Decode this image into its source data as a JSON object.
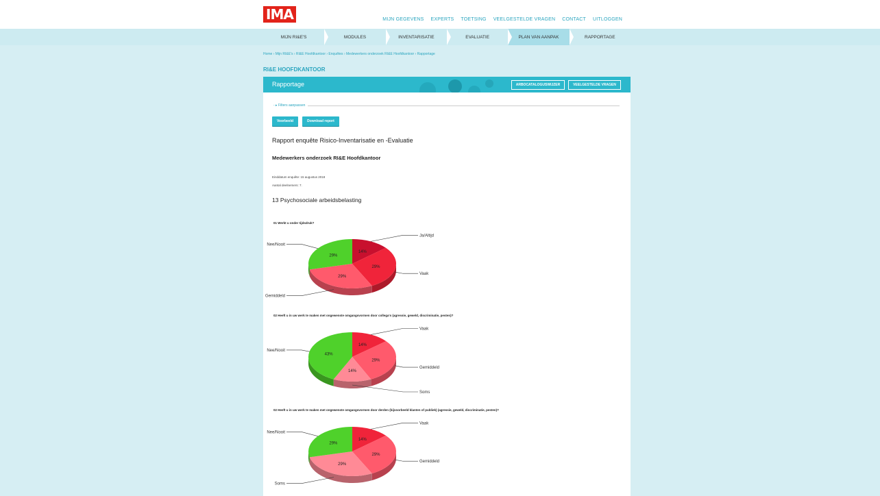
{
  "header": {
    "logo_text": "IMA",
    "nav": [
      "MIJN GEGEVENS",
      "EXPERTS",
      "TOETSING",
      "VEELGESTELDE VRAGEN",
      "CONTACT",
      "UITLOGGEN"
    ]
  },
  "mainnav": {
    "items": [
      "MIJN RI&E'S",
      "MODULES",
      "INVENTARISATIE",
      "EVALUATIE",
      "PLAN VAN AANPAK",
      "RAPPORTAGE"
    ],
    "active_index": 4
  },
  "breadcrumb": "Home › Mijn RI&E's › RI&E Hoofdkantoor › Enquêtes › Medewerkers onderzoek RI&E Hoofdkantoor › Rapportage",
  "section_title": "RI&E HOOFDKANTOOR",
  "panel": {
    "title": "Rapportage",
    "btn_catalog": "ARBOCATALOGUSWIJZER",
    "btn_faq": "VEELGESTELDE VRAGEN",
    "filters_label": "- ▸ Filters aanpassen",
    "btn_preview": "Voorbeeld",
    "btn_download": "Download report"
  },
  "report": {
    "title": "Rapport enquête Risico-Inventarisatie en -Evaluatie",
    "survey": "Medewerkers onderzoek RI&E Hoofdkantoor",
    "end_date": "Einddatum enquête: 15 augustus 2018",
    "participants": "Aantal deelnemers: 7.",
    "category": "13 Psychosociale arbeidsbelasting"
  },
  "colors": {
    "accent": "#2cb8cc",
    "link": "#2aa5bf",
    "green": "#4fd12b",
    "dark_red": "#c8102e",
    "red": "#f0243a",
    "pink": "#ff5a6c",
    "light_pink": "#ff8a96"
  },
  "chart_data": [
    {
      "type": "pie",
      "title": "01 Werkt u onder tijdsdruk?",
      "slices": [
        {
          "label": "Ja/Altijd",
          "value": 14,
          "color": "#c8102e"
        },
        {
          "label": "Vaak",
          "value": 29,
          "color": "#f0243a"
        },
        {
          "label": "Gemiddeld",
          "value": 29,
          "color": "#ff5a6c"
        },
        {
          "label": "Nee/Nooit",
          "value": 29,
          "color": "#4fd12b"
        }
      ]
    },
    {
      "type": "pie",
      "title": "02 Heeft u in uw werk te maken met ongewenste omgangsvormen door collega's (agressie, geweld, discriminatie, pesten)?",
      "slices": [
        {
          "label": "Vaak",
          "value": 14,
          "color": "#f0243a"
        },
        {
          "label": "Gemiddeld",
          "value": 29,
          "color": "#ff5a6c"
        },
        {
          "label": "Soms",
          "value": 14,
          "color": "#ff8a96"
        },
        {
          "label": "Nee/Nooit",
          "value": 43,
          "color": "#4fd12b"
        }
      ]
    },
    {
      "type": "pie",
      "title": "02 Heeft u in uw werk te maken met ongewenste omgangsvormen door derden (bijvoorbeeld klanten of publiek) (agressie, geweld, discriminatie, pesten)?",
      "slices": [
        {
          "label": "Vaak",
          "value": 14,
          "color": "#f0243a"
        },
        {
          "label": "Gemiddeld",
          "value": 29,
          "color": "#ff5a6c"
        },
        {
          "label": "Soms",
          "value": 29,
          "color": "#ff8a96"
        },
        {
          "label": "Nee/Nooit",
          "value": 29,
          "color": "#4fd12b"
        }
      ]
    }
  ]
}
